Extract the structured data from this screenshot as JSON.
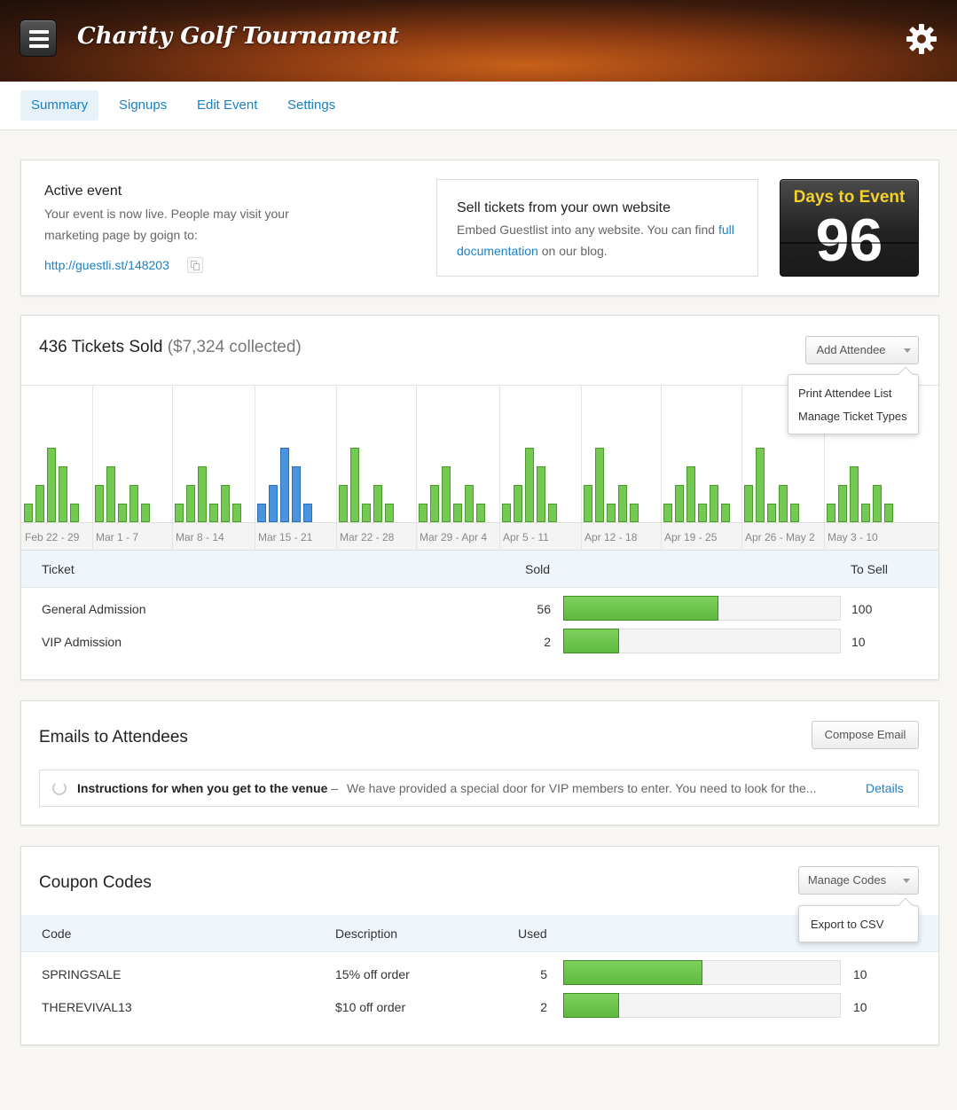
{
  "header": {
    "title": "Charity Golf Tournament",
    "menu_icon": "hamburger-icon",
    "settings_icon": "gear-icon"
  },
  "tabs": [
    {
      "label": "Summary",
      "active": true
    },
    {
      "label": "Signups",
      "active": false
    },
    {
      "label": "Edit Event",
      "active": false
    },
    {
      "label": "Settings",
      "active": false
    }
  ],
  "active_event": {
    "title": "Active event",
    "text": "Your event is now live. People may visit your marketing page by goign to:",
    "link": "http://guestli.st/148203",
    "copy_icon": "copy-icon"
  },
  "sell_box": {
    "title": "Sell tickets from your own website",
    "text_before": "Embed Guestlist into any website. You can find ",
    "link_text": "full documentation",
    "text_after": " on our blog."
  },
  "countdown": {
    "label": "Days to Event",
    "value": "96"
  },
  "tickets": {
    "title_main": "436 Tickets Sold",
    "title_sub": "($7,324 collected)",
    "add_button": "Add Attendee",
    "dropdown": [
      "Print Attendee List",
      "Manage Ticket Types"
    ],
    "headers": {
      "ticket": "Ticket",
      "sold": "Sold",
      "to_sell": "To Sell"
    },
    "rows": [
      {
        "name": "General Admission",
        "sold": "56",
        "to_sell": "100",
        "fraction": 0.56
      },
      {
        "name": "VIP Admission",
        "sold": "2",
        "to_sell": "10",
        "fraction": 0.2
      }
    ]
  },
  "chart_data": {
    "type": "bar",
    "highlight_color": "#4a93dd",
    "base_color": "#74c954",
    "weeks": [
      {
        "label": "Feb 22 - 29",
        "values": [
          1,
          2,
          4,
          3,
          1
        ],
        "highlight": false
      },
      {
        "label": "Mar 1 - 7",
        "values": [
          2,
          3,
          1,
          2,
          1
        ],
        "highlight": false
      },
      {
        "label": "Mar 8 - 14",
        "values": [
          1,
          2,
          3,
          1,
          2,
          1
        ],
        "highlight": false
      },
      {
        "label": "Mar 15 - 21",
        "values": [
          1,
          2,
          4,
          3,
          1
        ],
        "highlight": true
      },
      {
        "label": "Mar 22 - 28",
        "values": [
          2,
          4,
          1,
          2,
          1
        ],
        "highlight": false
      },
      {
        "label": "Mar 29 - Apr 4",
        "values": [
          1,
          2,
          3,
          1,
          2,
          1
        ],
        "highlight": false
      },
      {
        "label": "Apr 5 - 11",
        "values": [
          1,
          2,
          4,
          3,
          1
        ],
        "highlight": false
      },
      {
        "label": "Apr 12 - 18",
        "values": [
          2,
          4,
          1,
          2,
          1
        ],
        "highlight": false
      },
      {
        "label": "Apr 19 - 25",
        "values": [
          1,
          2,
          3,
          1,
          2,
          1
        ],
        "highlight": false
      },
      {
        "label": "Apr 26 - May 2",
        "values": [
          2,
          4,
          1,
          2,
          1
        ],
        "highlight": false
      },
      {
        "label": "May 3 - 10",
        "values": [
          1,
          2,
          3,
          1,
          2,
          1
        ],
        "highlight": false
      }
    ]
  },
  "emails": {
    "title": "Emails to Attendees",
    "compose_button": "Compose Email",
    "item": {
      "subject": "Instructions for when you get to the venue",
      "separator": "–",
      "preview": "We have provided a special door for VIP members to enter. You need to look for the...",
      "details": "Details"
    }
  },
  "coupons": {
    "title": "Coupon Codes",
    "manage_button": "Manage Codes",
    "dropdown": [
      "Export to CSV"
    ],
    "headers": {
      "code": "Code",
      "description": "Description",
      "used": "Used"
    },
    "rows": [
      {
        "code": "SPRINGSALE",
        "description": "15% off order",
        "used": "5",
        "total": "10",
        "fraction": 0.5
      },
      {
        "code": "THEREVIVAL13",
        "description": "$10 off order",
        "used": "2",
        "total": "10",
        "fraction": 0.2
      }
    ]
  }
}
